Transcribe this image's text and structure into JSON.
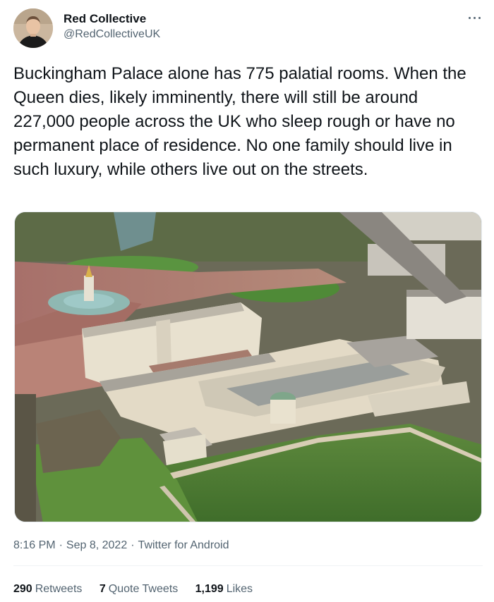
{
  "tweet": {
    "author": {
      "display_name": "Red Collective",
      "handle": "@RedCollectiveUK"
    },
    "text": "Buckingham Palace alone has 775 palatial rooms. When the Queen dies, likely imminently, there will still be around 227,000 people across the UK who sleep rough or have no permanent place of residence. No one family should live in such luxury, while others live out on the streets.",
    "media": {
      "icon": "photo-aerial-buckingham-palace"
    },
    "time": "8:16 PM",
    "date": "Sep 8, 2022",
    "source": "Twitter for Android",
    "stats": {
      "retweets_count": "290",
      "retweets_label": "Retweets",
      "quotes_count": "7",
      "quotes_label": "Quote Tweets",
      "likes_count": "1,199",
      "likes_label": "Likes"
    }
  }
}
